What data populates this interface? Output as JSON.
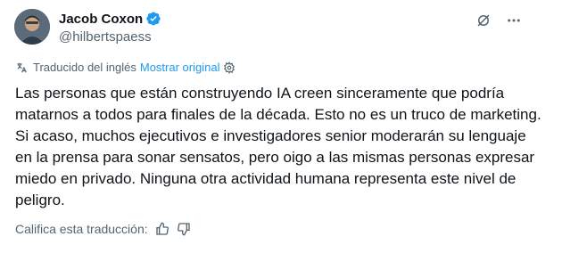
{
  "author": {
    "name": "Jacob Coxon",
    "handle": "@hilbertspaess",
    "verified": true
  },
  "icons": {
    "verified": "verified-badge-icon",
    "grok": "grok-icon",
    "more": "more-icon",
    "translate": "translate-icon",
    "settings": "gear-icon",
    "thumbs_up": "thumbs-up-icon",
    "thumbs_down": "thumbs-down-icon"
  },
  "translation": {
    "label": "Traducido del inglés",
    "show_original": "Mostrar original"
  },
  "tweet": {
    "text": "Las personas que están construyendo IA creen sinceramente que podría matarnos a todos para finales de la década. Esto no es un truco de marketing. Si acaso, muchos ejecutivos e investigadores senior moderarán su lenguaje en la prensa para sonar sensatos, pero oigo a las mismas personas expresar miedo en privado. Ninguna otra actividad humana representa este nivel de peligro."
  },
  "rating": {
    "label": "Califica esta traducción:"
  },
  "colors": {
    "text": "#0f1419",
    "secondary": "#536471",
    "accent": "#1d9bf0"
  }
}
